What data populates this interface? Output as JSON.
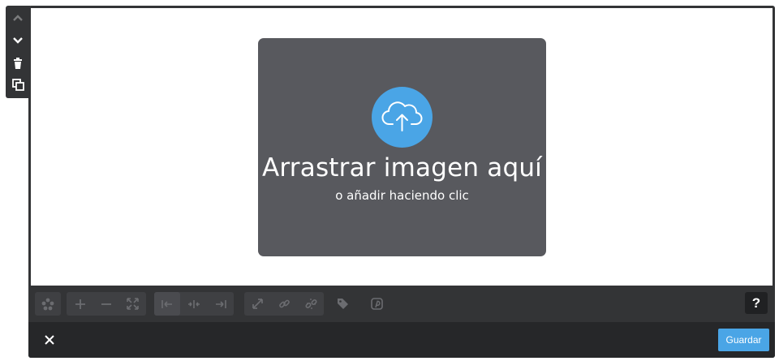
{
  "dropzone": {
    "title": "Arrastrar imagen aquí",
    "subtitle": "o añadir haciendo clic",
    "icon": "cloud-upload-icon"
  },
  "side_toolbar": {
    "items": [
      {
        "name": "move-up",
        "icon": "chevron-up-icon",
        "enabled": false
      },
      {
        "name": "move-down",
        "icon": "chevron-down-icon",
        "enabled": true
      },
      {
        "name": "delete",
        "icon": "trash-icon",
        "enabled": true
      },
      {
        "name": "duplicate",
        "icon": "duplicate-icon",
        "enabled": true
      }
    ]
  },
  "toolbar": {
    "groups": [
      {
        "items": [
          "filters-icon"
        ]
      },
      {
        "items": [
          "zoom-in-icon",
          "zoom-out-icon",
          "fit-icon"
        ]
      },
      {
        "items": [
          "align-left-icon",
          "align-center-icon",
          "align-right-icon"
        ]
      },
      {
        "items": [
          "expand-icon",
          "link-icon",
          "unlink-icon"
        ]
      },
      {
        "items": [
          "tag-icon"
        ]
      },
      {
        "items": [
          "pinterest-icon"
        ]
      }
    ],
    "active": "align-left-icon",
    "help_label": "?"
  },
  "footer": {
    "close_icon": "close-icon",
    "save_label": "Guardar"
  },
  "colors": {
    "accent": "#4aa5e6",
    "chrome": "#333436",
    "footer": "#262729",
    "dropzone": "#58595e"
  }
}
